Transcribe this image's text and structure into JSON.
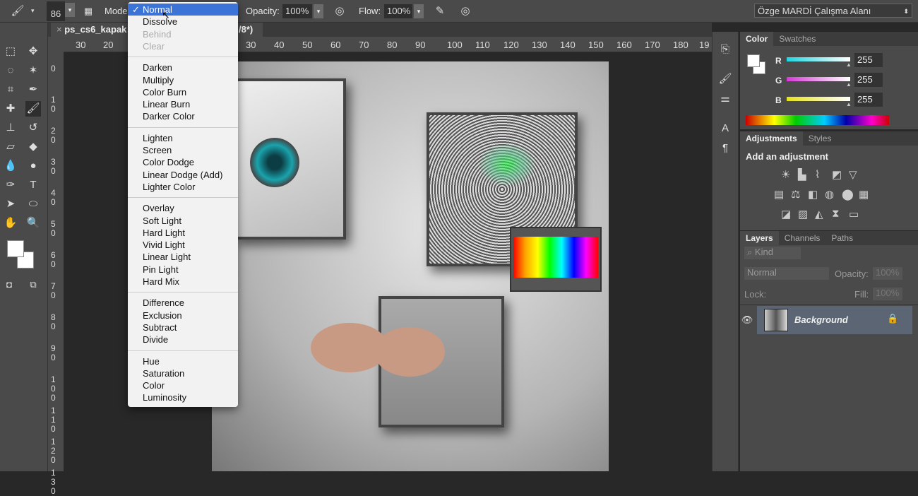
{
  "options": {
    "brush_size": "86",
    "mode_label": "Mode:",
    "opacity_label": "Opacity:",
    "opacity": "100%",
    "flow_label": "Flow:",
    "flow": "100%",
    "workspace": "Özge MARDİ Çalışma Alanı"
  },
  "document_tab": {
    "title": "ps_cs6_kapak",
    "suffix": "/8*)"
  },
  "hruler": [
    "30",
    "20",
    "30",
    "40",
    "50",
    "60",
    "70",
    "80",
    "90",
    "100",
    "110",
    "120",
    "130",
    "140",
    "150",
    "160",
    "170",
    "180",
    "19"
  ],
  "vruler": [
    "0",
    "10",
    "20",
    "30",
    "40",
    "50",
    "60",
    "70",
    "80",
    "90",
    "100",
    "110",
    "120",
    "130"
  ],
  "blend_menu": {
    "groups": [
      [
        {
          "label": "Normal",
          "selected": true
        },
        {
          "label": "Dissolve"
        },
        {
          "label": "Behind",
          "disabled": true
        },
        {
          "label": "Clear",
          "disabled": true
        }
      ],
      [
        {
          "label": "Darken"
        },
        {
          "label": "Multiply"
        },
        {
          "label": "Color Burn"
        },
        {
          "label": "Linear Burn"
        },
        {
          "label": "Darker Color"
        }
      ],
      [
        {
          "label": "Lighten"
        },
        {
          "label": "Screen"
        },
        {
          "label": "Color Dodge"
        },
        {
          "label": "Linear Dodge (Add)"
        },
        {
          "label": "Lighter Color"
        }
      ],
      [
        {
          "label": "Overlay"
        },
        {
          "label": "Soft Light"
        },
        {
          "label": "Hard Light"
        },
        {
          "label": "Vivid Light"
        },
        {
          "label": "Linear Light"
        },
        {
          "label": "Pin Light"
        },
        {
          "label": "Hard Mix"
        }
      ],
      [
        {
          "label": "Difference"
        },
        {
          "label": "Exclusion"
        },
        {
          "label": "Subtract"
        },
        {
          "label": "Divide"
        }
      ],
      [
        {
          "label": "Hue"
        },
        {
          "label": "Saturation"
        },
        {
          "label": "Color"
        },
        {
          "label": "Luminosity"
        }
      ]
    ],
    "check": "✓"
  },
  "color_panel": {
    "tabs": [
      "Color",
      "Swatches"
    ],
    "channels": [
      {
        "name": "R",
        "value": "255",
        "color": "#1fd6e0"
      },
      {
        "name": "G",
        "value": "255",
        "color": "#d63ad6"
      },
      {
        "name": "B",
        "value": "255",
        "color": "#e6e21a"
      }
    ]
  },
  "adjustments_panel": {
    "tabs": [
      "Adjustments",
      "Styles"
    ],
    "heading": "Add an adjustment"
  },
  "layers_panel": {
    "tabs": [
      "Layers",
      "Channels",
      "Paths"
    ],
    "kind": "Kind",
    "blend": "Normal",
    "opacity_label": "Opacity:",
    "opacity": "100%",
    "lock_label": "Lock:",
    "fill_label": "Fill:",
    "fill": "100%",
    "layers": [
      {
        "name": "Background"
      }
    ]
  }
}
